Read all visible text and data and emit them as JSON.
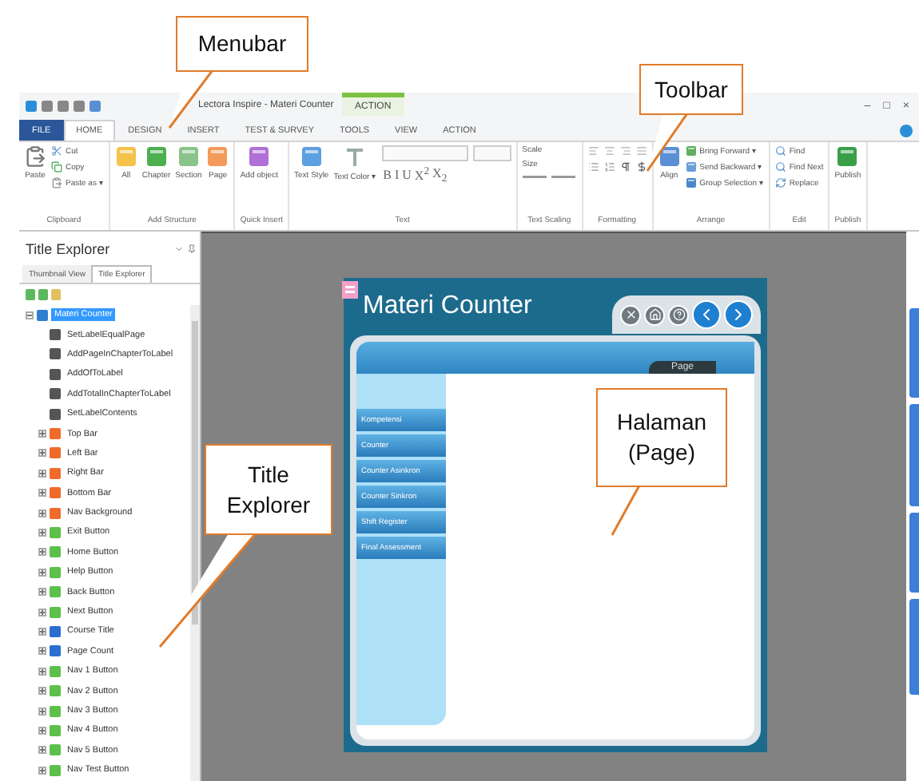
{
  "callouts": [
    {
      "lines": [
        "Menubar"
      ]
    },
    {
      "lines": [
        "Toolbar"
      ]
    },
    {
      "lines": [
        "Title",
        "Explorer"
      ]
    },
    {
      "lines": [
        "Halaman",
        "(Page)"
      ]
    }
  ],
  "window": {
    "title": "Lectora Inspire - Materi Counter",
    "context_tab": "ACTION",
    "controls": [
      "–",
      "□",
      "×"
    ]
  },
  "tabs": [
    {
      "label": "FILE",
      "kind": "file",
      "selected": false
    },
    {
      "label": "HOME",
      "kind": "tab",
      "selected": true
    },
    {
      "label": "DESIGN",
      "kind": "tab",
      "selected": false
    },
    {
      "label": "INSERT",
      "kind": "tab",
      "selected": false
    },
    {
      "label": "TEST & SURVEY",
      "kind": "tab",
      "selected": false
    },
    {
      "label": "TOOLS",
      "kind": "tab",
      "selected": false
    },
    {
      "label": "VIEW",
      "kind": "tab",
      "selected": false
    },
    {
      "label": "ACTION",
      "kind": "tab",
      "selected": false
    }
  ],
  "ribbon": {
    "groups": [
      {
        "label": "Clipboard",
        "kind": "buttons",
        "items": [
          {
            "label": "Paste",
            "kind": "large"
          },
          {
            "label": "Cut",
            "kind": "small"
          },
          {
            "label": "Copy",
            "kind": "small"
          },
          {
            "label": "Paste as ▾",
            "kind": "small"
          }
        ]
      },
      {
        "label": "Add Structure",
        "kind": "buttons",
        "items": [
          {
            "label": "All",
            "kind": "large"
          },
          {
            "label": "Chapter",
            "kind": "large"
          },
          {
            "label": "Section",
            "kind": "large"
          },
          {
            "label": "Page",
            "kind": "large"
          }
        ]
      },
      {
        "label": "Quick Insert",
        "kind": "buttons",
        "items": [
          {
            "label": "Add object",
            "kind": "large"
          }
        ]
      },
      {
        "label": "Text",
        "kind": "text",
        "items": [
          {
            "label": "Text Style",
            "kind": "large"
          },
          {
            "label": "Text Color ▾",
            "kind": "large"
          }
        ],
        "styles": [
          "B",
          "I",
          "U",
          "X$^{2}$",
          "X$_{2}$"
        ]
      },
      {
        "label": "Text Scaling",
        "kind": "scaling",
        "items": [
          {
            "label": "Scale",
            "kind": "label"
          },
          {
            "label": "Size",
            "kind": "label"
          }
        ]
      },
      {
        "label": "Formatting",
        "kind": "formatting"
      },
      {
        "label": "Arrange",
        "kind": "buttons",
        "items": [
          {
            "label": "Align",
            "kind": "large"
          },
          {
            "label": "Bring Forward ▾",
            "kind": "small"
          },
          {
            "label": "Send Backward ▾",
            "kind": "small"
          },
          {
            "label": "Group Selection ▾",
            "kind": "small"
          }
        ]
      },
      {
        "label": "Edit",
        "kind": "buttons",
        "items": [
          {
            "label": "Find",
            "kind": "small"
          },
          {
            "label": "Find Next",
            "kind": "small"
          },
          {
            "label": "Replace",
            "kind": "small"
          }
        ]
      },
      {
        "label": "Publish",
        "kind": "buttons",
        "items": [
          {
            "label": "Publish",
            "kind": "large"
          }
        ]
      }
    ]
  },
  "title_explorer": {
    "title": "Title Explorer",
    "tabs": [
      {
        "label": "Thumbnail View",
        "selected": false
      },
      {
        "label": "Title Explorer",
        "selected": true
      }
    ],
    "tree": [
      {
        "label": "Materi Counter",
        "kind": "title",
        "selected": true,
        "expanded": true,
        "children": [
          {
            "label": "SetLabelEqualPage",
            "kind": "action",
            "selected": false
          },
          {
            "label": "AddPageInChapterToLabel",
            "kind": "action",
            "selected": false
          },
          {
            "label": "AddOfToLabel",
            "kind": "action",
            "selected": false
          },
          {
            "label": "AddTotalInChapterToLabel",
            "kind": "action",
            "selected": false
          },
          {
            "label": "SetLabelContents",
            "kind": "action",
            "selected": false
          },
          {
            "label": "Top Bar",
            "kind": "image",
            "selected": false,
            "expanded": false
          },
          {
            "label": "Left Bar",
            "kind": "image",
            "selected": false,
            "expanded": false
          },
          {
            "label": "Right Bar",
            "kind": "image",
            "selected": false,
            "expanded": false
          },
          {
            "label": "Bottom Bar",
            "kind": "image",
            "selected": false,
            "expanded": false
          },
          {
            "label": "Nav Background",
            "kind": "image",
            "selected": false,
            "expanded": false
          },
          {
            "label": "Exit Button",
            "kind": "button",
            "selected": false,
            "expanded": false
          },
          {
            "label": "Home Button",
            "kind": "button",
            "selected": false,
            "expanded": false
          },
          {
            "label": "Help Button",
            "kind": "button",
            "selected": false,
            "expanded": false
          },
          {
            "label": "Back Button",
            "kind": "button",
            "selected": false,
            "expanded": false
          },
          {
            "label": "Next Button",
            "kind": "button",
            "selected": false,
            "expanded": false
          },
          {
            "label": "Course Title",
            "kind": "text",
            "selected": false,
            "expanded": false
          },
          {
            "label": "Page Count",
            "kind": "text",
            "selected": false,
            "expanded": false
          },
          {
            "label": "Nav 1 Button",
            "kind": "button",
            "selected": false,
            "expanded": false
          },
          {
            "label": "Nav 2 Button",
            "kind": "button",
            "selected": false,
            "expanded": false
          },
          {
            "label": "Nav 3 Button",
            "kind": "button",
            "selected": false,
            "expanded": false
          },
          {
            "label": "Nav 4 Button",
            "kind": "button",
            "selected": false,
            "expanded": false
          },
          {
            "label": "Nav 5 Button",
            "kind": "button",
            "selected": false,
            "expanded": false
          },
          {
            "label": "Nav Test Button",
            "kind": "button",
            "selected": false,
            "expanded": false
          }
        ]
      }
    ]
  },
  "page": {
    "title": "Materi Counter",
    "tab": "Page",
    "menu": [
      "Kompetensi",
      "Counter",
      "Counter Asinkron",
      "Counter Sinkron",
      "Shift Register",
      "Final Assessment"
    ]
  }
}
